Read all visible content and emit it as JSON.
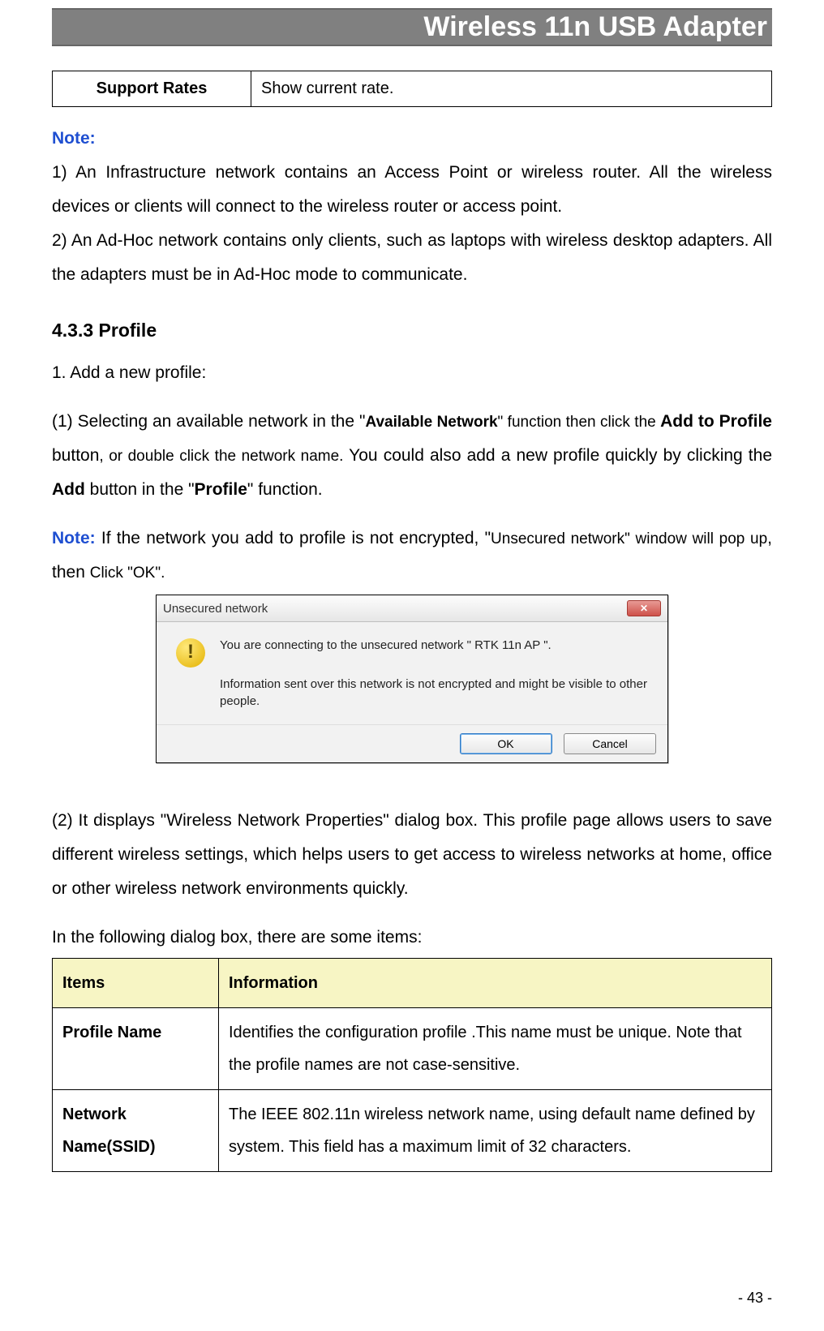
{
  "banner": "Wireless 11n USB Adapter",
  "rate_table": {
    "left": "Support Rates",
    "right": "Show current rate."
  },
  "note_block": {
    "note_label": "Note:",
    "l1": "1) An Infrastructure network contains an Access Point or wireless router. All the wireless devices or clients will connect to the wireless router or access point.",
    "l2": "2) An Ad-Hoc network contains only clients, such as laptops with wireless desktop adapters. All the adapters must be in Ad-Hoc mode to communicate."
  },
  "section_heading": "4.3.3    Profile",
  "profile_body": {
    "p1": "1. Add a new profile:",
    "p2_a": "(1) Selecting an available network in the \"",
    "p2_b": "Available Network",
    "p2_c": "\" function then click the ",
    "p2_d": "Add to Profile",
    "p2_e": " button",
    "p2_f": ", or double click the network name.",
    "p2_g": " You could also add a new profile quickly by clicking the ",
    "p2_h": "Add",
    "p2_i": " button in the \"",
    "p2_j": "Profile",
    "p2_k": "\" function.",
    "note_label": "Note:",
    "p3_a": " If the network you add to profile is not encrypted, \"",
    "p3_b": "Unsecured network",
    "p3_c": "\" window will pop up",
    "p3_d": ", then ",
    "p3_e": "Click \"OK\"."
  },
  "dialog": {
    "title": "Unsecured network",
    "line1": "You are connecting to the unsecured network \"  RTK 11n AP  \".",
    "line2": "Information sent over this network is not encrypted and might be visible to other people.",
    "ok": "OK",
    "cancel": "Cancel"
  },
  "para2": "(2) It displays \"Wireless Network Properties\" dialog box. This profile page allows users to save different wireless settings, which helps users to get access to wireless networks at home, office or other wireless network environments quickly.",
  "para3": "In the following dialog box, there are some items:",
  "items_table": {
    "head": [
      "Items",
      "Information"
    ],
    "rows": [
      {
        "c0": "Profile Name",
        "c1": "Identifies the configuration profile .This name must be unique. Note that the profile names are not case-sensitive."
      },
      {
        "c0": "Network Name(SSID)",
        "c1": "The IEEE 802.11n wireless network name, using default name defined by system. This field has a maximum limit of 32 characters."
      }
    ]
  },
  "page_number": "- 43 -"
}
